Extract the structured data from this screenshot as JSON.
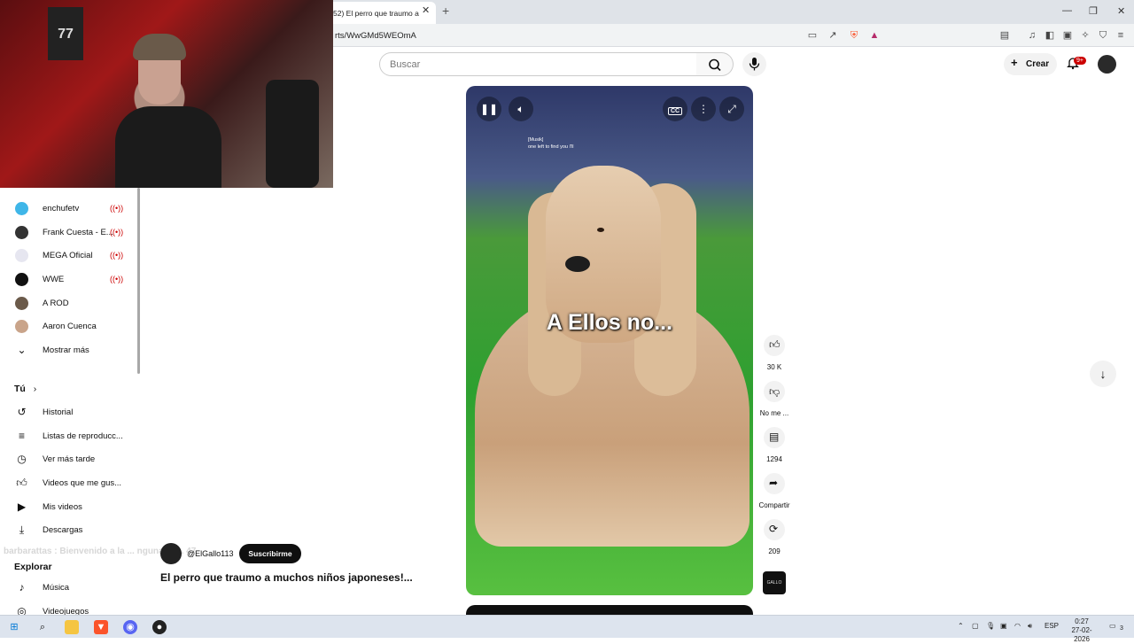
{
  "browser": {
    "tab_title": "52) El perro que traumo a",
    "tab_close": "✕",
    "new_tab": "+",
    "url": "rts/WwGMd5WEOmA",
    "window_controls": [
      "—",
      "❐",
      "✕"
    ]
  },
  "youtube_header": {
    "search_placeholder": "Buscar",
    "create_label": "Crear",
    "notifications_badge": "9+"
  },
  "sidebar": {
    "subscriptions": [
      {
        "label": "enchufetv",
        "live": true,
        "color": "#3fb6e8"
      },
      {
        "label": "Frank Cuesta - E...",
        "live": true,
        "color": "#333333"
      },
      {
        "label": "MEGA Oficial",
        "live": true,
        "color": "#e6e6f0"
      },
      {
        "label": "WWE",
        "live": true,
        "color": "#111111"
      },
      {
        "label": "A ROD",
        "live": false,
        "color": "#6b5a4a"
      },
      {
        "label": "Aaron Cuenca",
        "live": false,
        "color": "#c9a48a"
      }
    ],
    "show_more": "Mostrar más",
    "you_heading": "Tú",
    "you_items": [
      {
        "label": "Historial",
        "icon": "history-icon"
      },
      {
        "label": "Listas de reproducc...",
        "icon": "playlist-icon"
      },
      {
        "label": "Ver más tarde",
        "icon": "clock-icon"
      },
      {
        "label": "Videos que me gus...",
        "icon": "thumb-up-icon"
      },
      {
        "label": "Mis videos",
        "icon": "video-icon"
      },
      {
        "label": "Descargas",
        "icon": "download-icon"
      }
    ],
    "explore_heading": "Explorar",
    "explore_items": [
      {
        "label": "Música",
        "icon": "music-icon"
      },
      {
        "label": "Videojuegos",
        "icon": "gamepad-icon"
      }
    ]
  },
  "webcam": {
    "jersey_number": "77"
  },
  "player": {
    "caption_main": "A Ellos no...",
    "caption_small_1": "[Musik]",
    "caption_small_2": "one left to find you I'll",
    "cc_label": "CC"
  },
  "actions": {
    "likes": "30 K",
    "dislike": "No me ...",
    "comments": "1294",
    "share": "Compartir",
    "remix": "209",
    "channel_thumb_label": "GALLO"
  },
  "video": {
    "channel_handle": "@ElGallo113",
    "subscribe_label": "Suscribirme",
    "title": "El perro que traumo a muchos niños japoneses!...",
    "chat_overlay": "barbarattas : Bienvenido a la ... ngunaga ... 47"
  },
  "taskbar": {
    "language": "ESP",
    "time": "0:27",
    "date": "27-02-2026",
    "notif_count": "3"
  },
  "colors": {
    "live": "#cc0000",
    "accent": "#0f0f0f",
    "badge": "#cc0000"
  }
}
